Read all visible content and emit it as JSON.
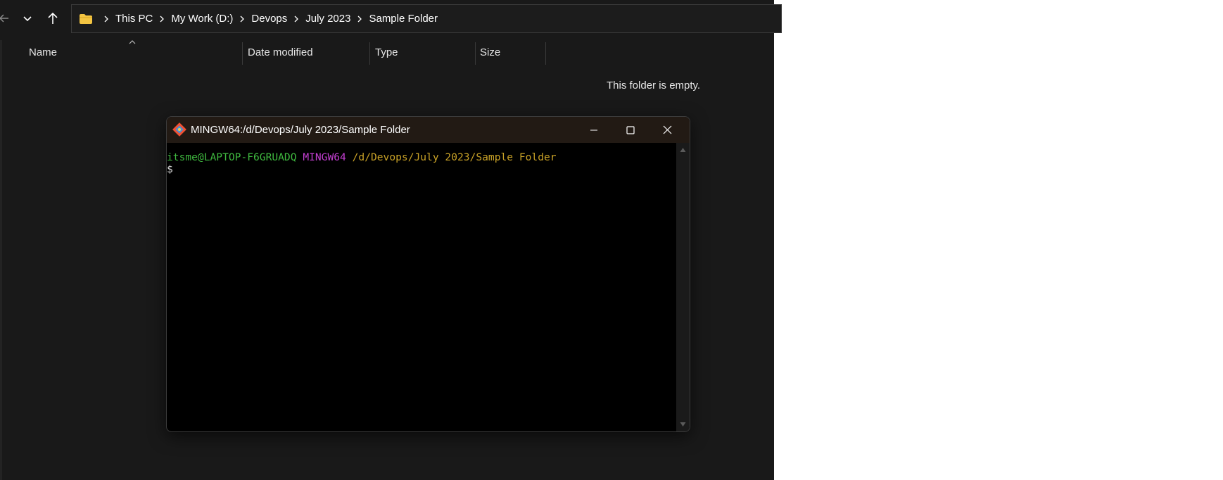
{
  "explorer": {
    "address": {
      "crumbs": [
        "This PC",
        "My Work (D:)",
        "Devops",
        "July 2023",
        "Sample Folder"
      ]
    },
    "columns": {
      "name": "Name",
      "date_modified": "Date modified",
      "type": "Type",
      "size": "Size"
    },
    "empty_message": "This folder is empty.",
    "icons": {
      "back": "back-arrow-icon",
      "history": "chevron-down-icon",
      "up": "up-arrow-icon",
      "folder": "folder-icon"
    },
    "colors": {
      "background": "#191919",
      "folder": "#f4c542"
    }
  },
  "terminal": {
    "title": "MINGW64:/d/Devops/July 2023/Sample Folder",
    "prompt": {
      "user_host": "itsme@LAPTOP-F6GRUADQ",
      "env": "MINGW64",
      "path": "/d/Devops/July 2023/Sample Folder",
      "symbol": "$"
    },
    "colors": {
      "user_host": "#3fb93f",
      "env": "#c33fd1",
      "path": "#c9a227",
      "symbol": "#d9d9d9",
      "background": "#000000",
      "titlebar": "#221a14"
    }
  }
}
